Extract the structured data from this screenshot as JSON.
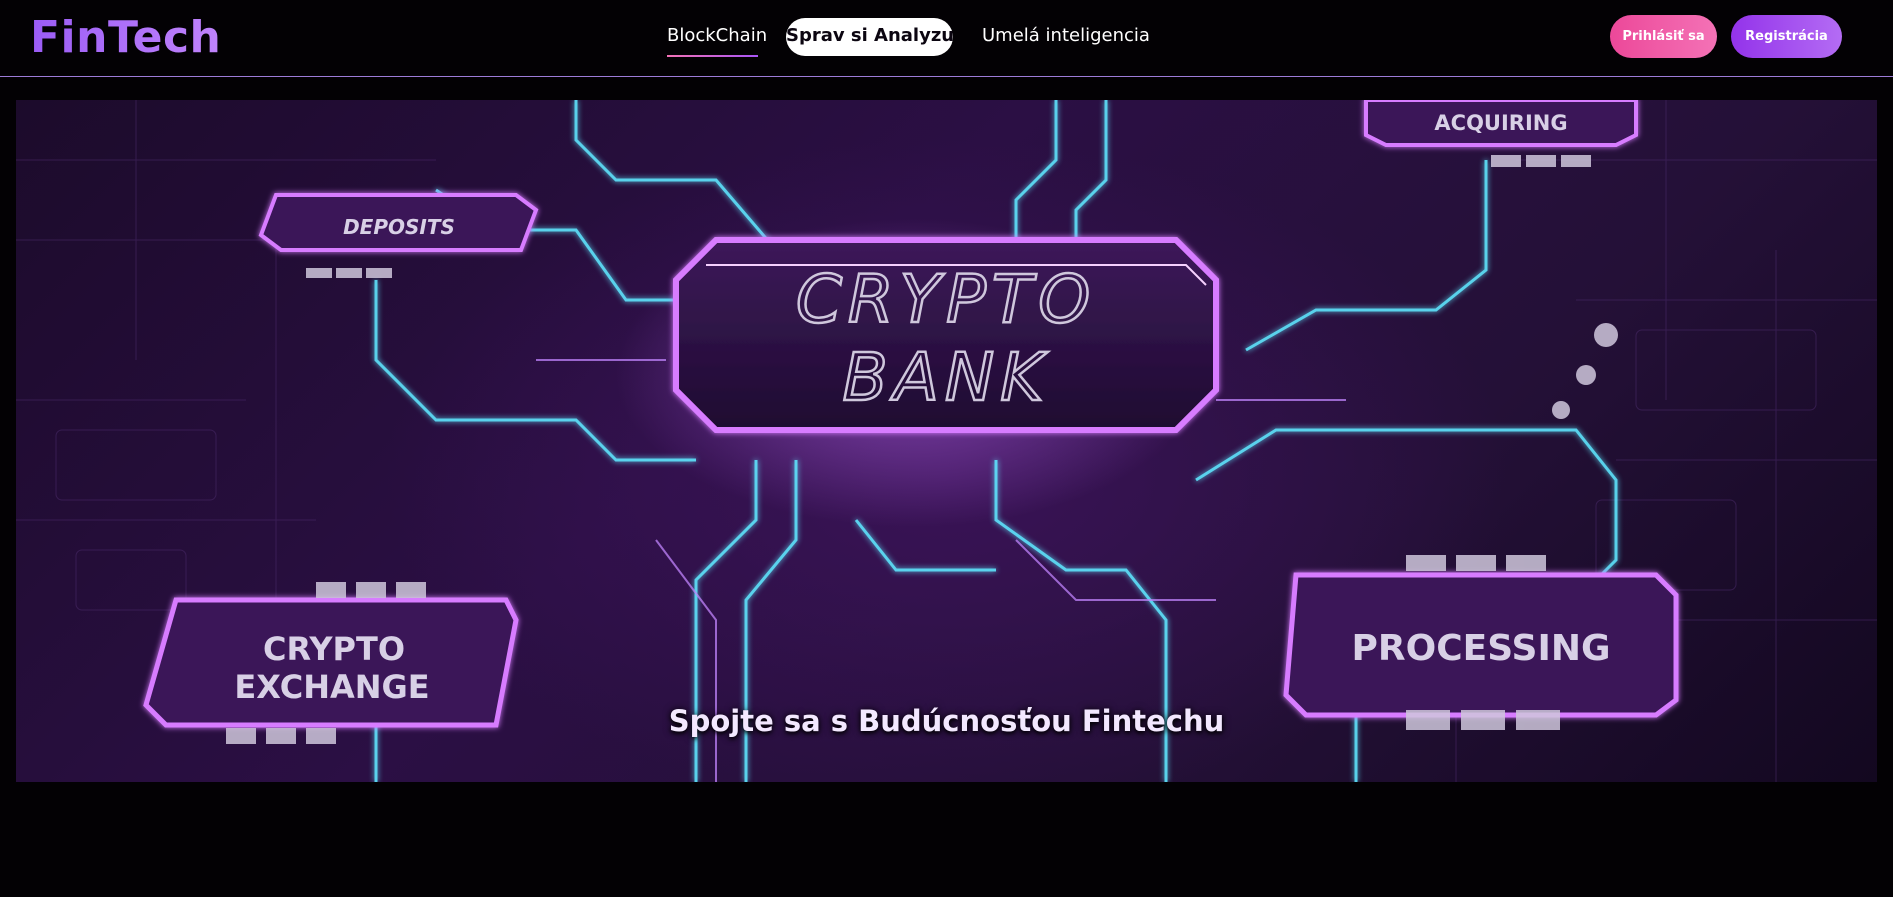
{
  "brand": {
    "logo": "FinTech"
  },
  "nav": {
    "items": [
      {
        "label": "BlockChain"
      },
      {
        "label": "Sprav si Analyzu"
      },
      {
        "label": "Umelá inteligencia"
      }
    ]
  },
  "auth": {
    "login_label": "Prihlásiť sa",
    "register_label": "Registrácia"
  },
  "hero": {
    "caption": "Spojte sa s Budúcnosťou Fintechu",
    "image_labels": {
      "center_line1": "CRYPTO",
      "center_line2": "BANK",
      "deposits": "DEPOSITS",
      "acquiring": "ACQUIRING",
      "exchange_line1": "CRYPTO",
      "exchange_line2": "EXCHANGE",
      "processing": "PROCESSING"
    }
  },
  "colors": {
    "accent_purple": "#9b5cf6",
    "accent_pink": "#ec4899",
    "header_border": "#9d7bd8",
    "background": "#030104"
  }
}
